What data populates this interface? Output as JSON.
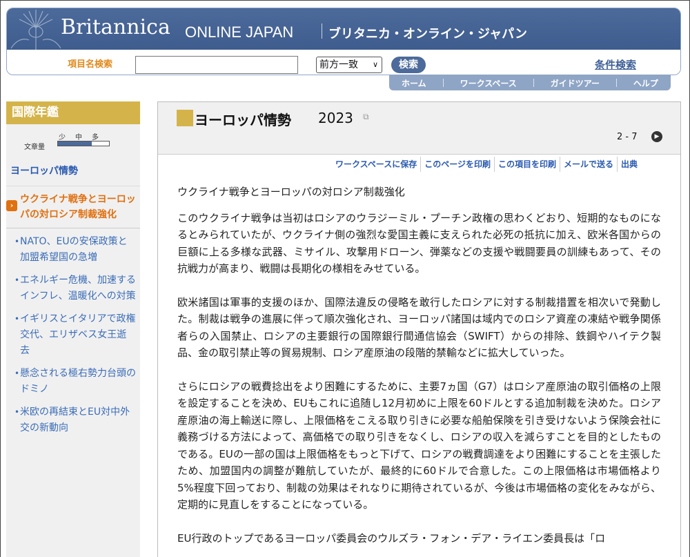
{
  "header": {
    "brand": "Britannica",
    "brand_sub": "ONLINE JAPAN",
    "brand_jp": "ブリタニカ・オンライン・ジャパン"
  },
  "search": {
    "label": "項目名検索",
    "value": "",
    "match_mode": "前方一致",
    "submit": "検索",
    "advanced": "条件検索"
  },
  "nav": [
    "ホーム",
    "ワークスペース",
    "ガイドツアー",
    "ヘルプ"
  ],
  "sidebar": {
    "title": "国際年鑑",
    "density_label": "文章量",
    "density_levels": [
      "少",
      "中",
      "多"
    ],
    "density_level": 0.66,
    "topic": "ヨーロッパ情勢",
    "current": "ウクライナ戦争とヨーロッパの対ロシア制裁強化",
    "items": [
      "NATO、EUの安保政策と加盟希望国の急増",
      "エネルギー危機、加速するインフレ、温暖化への対策",
      "イギリスとイタリアで政権交代、エリザベス女王逝去",
      "懸念される極右勢力台頭のドミノ",
      "米欧の再結束とEU対中外交の新動向"
    ]
  },
  "main": {
    "title": "ヨーロッパ情勢",
    "year": "2023",
    "page_indicator": "2 - 7",
    "actions": [
      "ワークスペースに保存",
      "このページを印刷",
      "この項目を印刷",
      "メールで送る",
      "出典"
    ],
    "section_title": "ウクライナ戦争とヨーロッパの対ロシア制裁強化",
    "paragraphs": [
      "このウクライナ戦争は当初はロシアのウラジーミル・プーチン政権の思わくどおり、短期的なものになるとみられていたが、ウクライナ側の強烈な愛国主義に支えられた必死の抵抗に加え、欧米各国からの巨額に上る多様な武器、ミサイル、攻撃用ドローン、弾薬などの支援や戦闘要員の訓練もあって、その抗戦力が高まり、戦闘は長期化の様相をみせている。",
      "欧米諸国は軍事的支援のほか、国際法違反の侵略を敢行したロシアに対する制裁措置を相次いで発動した。制裁は戦争の進展に伴って順次強化され、ヨーロッパ諸国は域内でのロシア資産の凍結や戦争関係者らの入国禁止、ロシアの主要銀行の国際銀行間通信協会（SWIFT）からの排除、鉄鋼やハイテク製品、金の取引禁止等の貿易規制、ロシア産原油の段階的禁輸などに拡大していった。",
      "さらにロシアの戦費捻出をより困難にするために、主要7ヵ国（G7）はロシア産原油の取引価格の上限を設定することを決め、EUもこれに追随し12月初めに上限を60ドルとする追加制裁を決めた。ロシア産原油の海上輸送に際し、上限価格をこえる取り引きに必要な船舶保険を引き受けないよう保険会社に義務づける方法によって、高価格での取り引きをなくし、ロシアの収入を減らすことを目的としたものである。EUの一部の国は上限価格をもっと下げて、ロシアの戦費調達をより困難にすることを主張したため、加盟国内の調整が難航していたが、最終的に60ドルで合意した。この上限価格は市場価格より5%程度下回っており、制裁の効果はそれなりに期待されているが、今後は市場価格の変化をみながら、定期的に見直しをすることになっている。",
      "EU行政のトップであるヨーロッパ委員会のウルズラ・フォン・デア・ライエン委員長は「ロ"
    ]
  },
  "colors": {
    "banner": "#4c6a9a",
    "accent_gold": "#d4b44a",
    "current_orange": "#e07010",
    "link_blue": "#3a6cb8"
  }
}
